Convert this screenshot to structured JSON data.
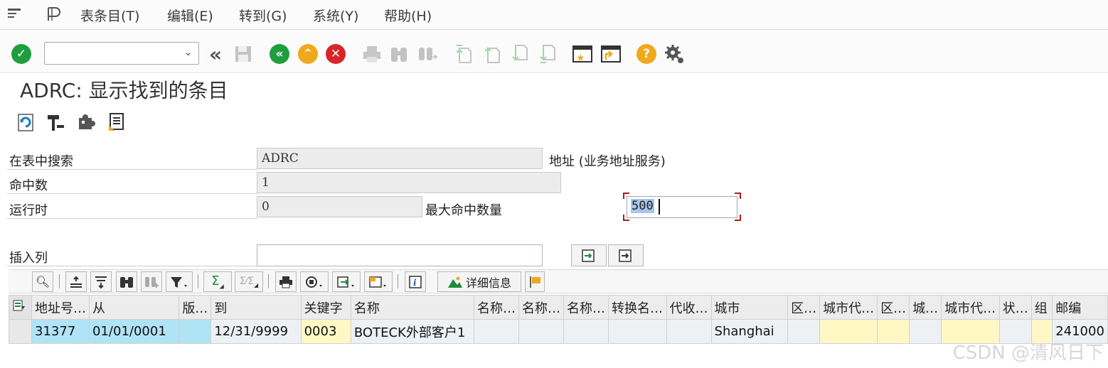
{
  "menu": {
    "items": [
      "表条目(T)",
      "编辑(E)",
      "转到(G)",
      "系统(Y)",
      "帮助(H)"
    ]
  },
  "toolbar": {
    "command_value": "",
    "icons": [
      "enter-icon",
      "back-icon",
      "exit-icon",
      "cancel-icon",
      "print-icon",
      "find-icon",
      "find-next-icon",
      "first-page-icon",
      "prev-page-icon",
      "next-page-icon",
      "last-page-icon",
      "new-session-icon",
      "shortcut-icon",
      "help-icon",
      "customize-icon"
    ]
  },
  "page": {
    "title": "ADRC: 显示找到的条目"
  },
  "form": {
    "search_table_label": "在表中搜索",
    "search_table_value": "ADRC",
    "search_table_desc": "地址 (业务地址服务)",
    "hits_label": "命中数",
    "hits_value": "1",
    "runtime_label": "运行时",
    "runtime_value": "0",
    "max_hits_label": "最大命中数量",
    "max_hits_value": "500",
    "insert_col_label": "插入列",
    "insert_col_value": ""
  },
  "grid_toolbar": {
    "details_label": "详细信息"
  },
  "table": {
    "headers": [
      "地址号…",
      "从",
      "版…",
      "到",
      "关键字",
      "名称",
      "名称…",
      "名称…",
      "名称…",
      "转换名…",
      "代收…",
      "城市",
      "区…",
      "城市代…",
      "区…",
      "城…",
      "城市代…",
      "状…",
      "组",
      "邮编"
    ],
    "rows": [
      [
        "31377",
        "01/01/0001",
        "",
        "12/31/9999",
        "0003",
        "BOTECK外部客户1",
        "",
        "",
        "",
        "",
        "",
        "Shanghai",
        "",
        "",
        "",
        "",
        "",
        "",
        "",
        "241000"
      ]
    ]
  },
  "watermark": "CSDN @清风日下",
  "colors": {
    "enter_green": "#1e9e3e",
    "back_green": "#1e9e3e",
    "exit_orange": "#f0a81c",
    "cancel_red": "#d9242a",
    "help_orange": "#f0a81c",
    "key_col": "#b0e3f5",
    "yellow_col": "#fff8c4"
  }
}
